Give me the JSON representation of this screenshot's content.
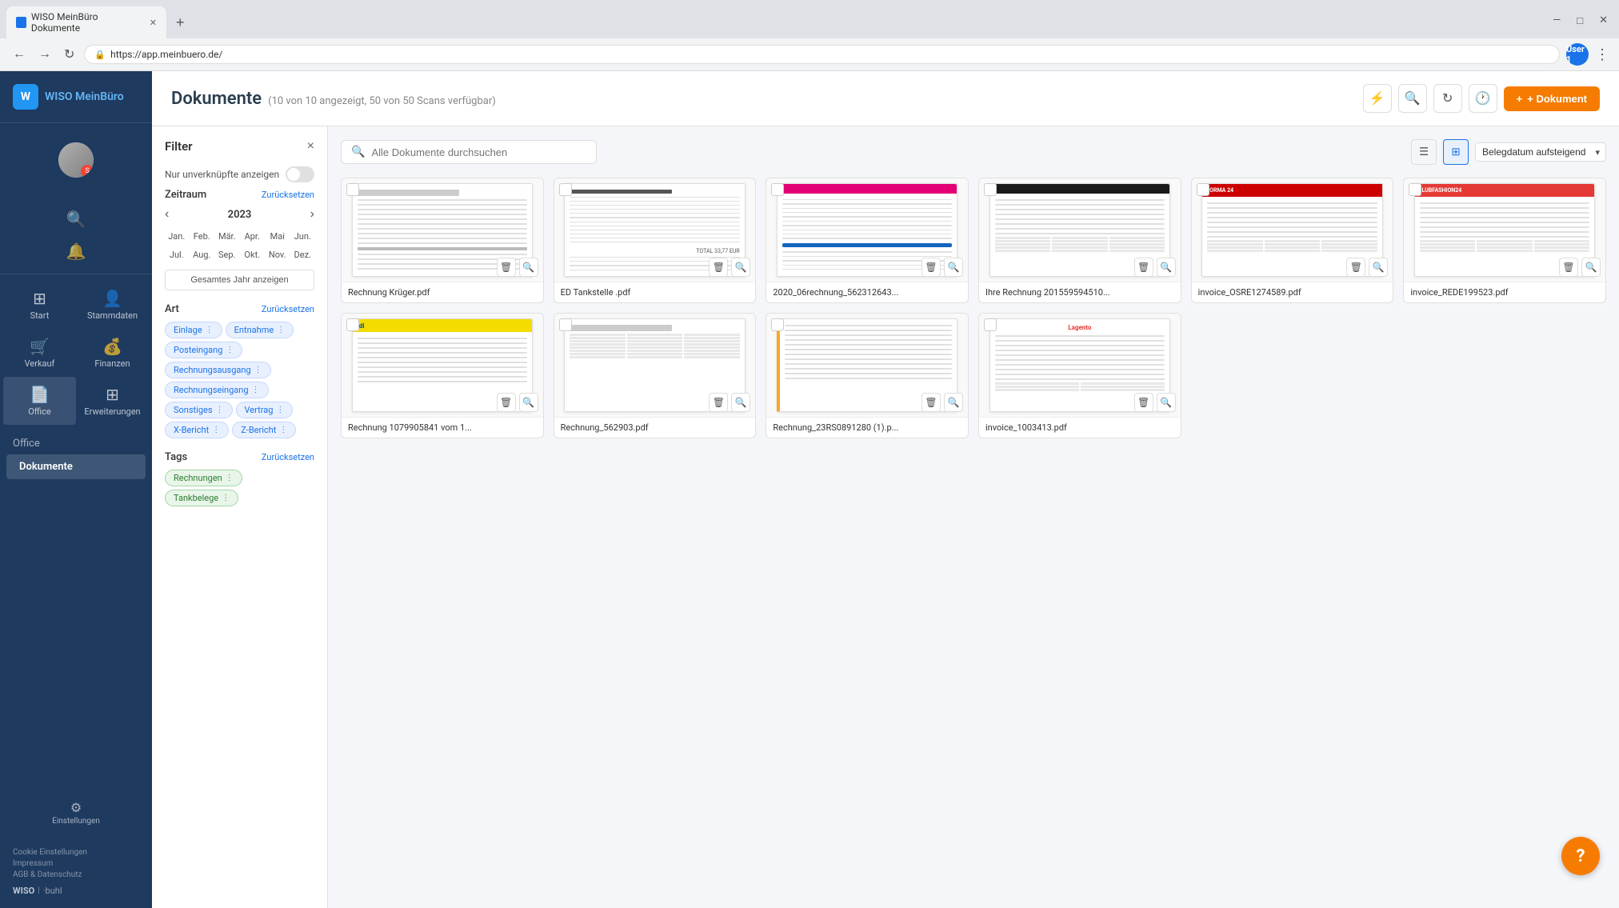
{
  "browser": {
    "tab_title": "WISO MeinBüro Dokumente",
    "url": "https://app.meinbuero.de/",
    "user_label": "User 1"
  },
  "sidebar": {
    "brand_name": "WISO MeinBüro",
    "nav_items": [
      {
        "id": "search",
        "icon": "🔍",
        "label": ""
      },
      {
        "id": "bell",
        "icon": "🔔",
        "label": ""
      }
    ],
    "section_items": [
      {
        "id": "start",
        "icon": "⊞",
        "label": "Start"
      },
      {
        "id": "stammdaten",
        "icon": "👤",
        "label": "Stammdaten"
      },
      {
        "id": "verkauf",
        "icon": "🛒",
        "label": "Verkauf"
      },
      {
        "id": "finanzen",
        "icon": "💰",
        "label": "Finanzen"
      },
      {
        "id": "office",
        "icon": "📄",
        "label": "Office"
      },
      {
        "id": "erweiterungen",
        "icon": "⊞",
        "label": "Erweiterungen"
      }
    ],
    "office_label": "Office",
    "dokumente_label": "Dokumente",
    "footer_links": [
      "Cookie Einstellungen",
      "Impressum",
      "AGB & Datenschutz"
    ],
    "settings_label": "Einstellungen"
  },
  "page": {
    "title": "Dokumente",
    "subtitle": "(10 von 10 angezeigt, 50 von 50 Scans verfügbar)",
    "add_button": "+ Dokument",
    "search_placeholder": "Alle Dokumente durchsuchen",
    "sort_label": "Belegdatum aufsteigend"
  },
  "filter": {
    "title": "Filter",
    "close_label": "×",
    "only_unlinked_label": "Nur unverknüpfte anzeigen",
    "period_label": "Zeitraum",
    "period_reset": "Zurücksetzen",
    "calendar_year": "2023",
    "months": [
      "Jan.",
      "Feb.",
      "Mär.",
      "Apr.",
      "Mai",
      "Jun.",
      "Jul.",
      "Aug.",
      "Sep.",
      "Okt.",
      "Nov.",
      "Dez."
    ],
    "show_all_year": "Gesamtes Jahr anzeigen",
    "type_label": "Art",
    "type_reset": "Zurücksetzen",
    "type_chips": [
      {
        "label": "Einlage",
        "has_menu": true
      },
      {
        "label": "Entnahme",
        "has_menu": true
      },
      {
        "label": "Posteingang",
        "has_menu": true
      },
      {
        "label": "Rechnungsausgang",
        "has_menu": true
      },
      {
        "label": "Rechnungseingang",
        "has_menu": true
      },
      {
        "label": "Sonstiges",
        "has_menu": true
      },
      {
        "label": "Vertrag",
        "has_menu": true
      },
      {
        "label": "X-Bericht",
        "has_menu": true
      },
      {
        "label": "Z-Bericht",
        "has_menu": true
      }
    ],
    "tags_label": "Tags",
    "tags_reset": "Zurücksetzen",
    "tag_chips": [
      {
        "label": "Rechnungen"
      },
      {
        "label": "Tankbelege"
      }
    ]
  },
  "documents": [
    {
      "id": 1,
      "name": "Rechnung Krüger.pdf",
      "type": "invoice_plain"
    },
    {
      "id": 2,
      "name": "ED Tankstelle .pdf",
      "type": "tankstelle"
    },
    {
      "id": 3,
      "name": "2020_06rechnung_562312643...",
      "type": "telekom"
    },
    {
      "id": 4,
      "name": "Ihre Rechnung 201559594510...",
      "type": "dark_header"
    },
    {
      "id": 5,
      "name": "invoice_OSRE1274589.pdf",
      "type": "norma"
    },
    {
      "id": 6,
      "name": "invoice_REDE199523.pdf",
      "type": "clubfashion"
    },
    {
      "id": 7,
      "name": "Rechnung 1079905841 vom 1...",
      "type": "lidl"
    },
    {
      "id": 8,
      "name": "Rechnung_562903.pdf",
      "type": "plain_table"
    },
    {
      "id": 9,
      "name": "Rechnung_23RS0891280 (1).p...",
      "type": "colorful_left"
    },
    {
      "id": 10,
      "name": "invoice_1003413.pdf",
      "type": "lagento"
    }
  ]
}
